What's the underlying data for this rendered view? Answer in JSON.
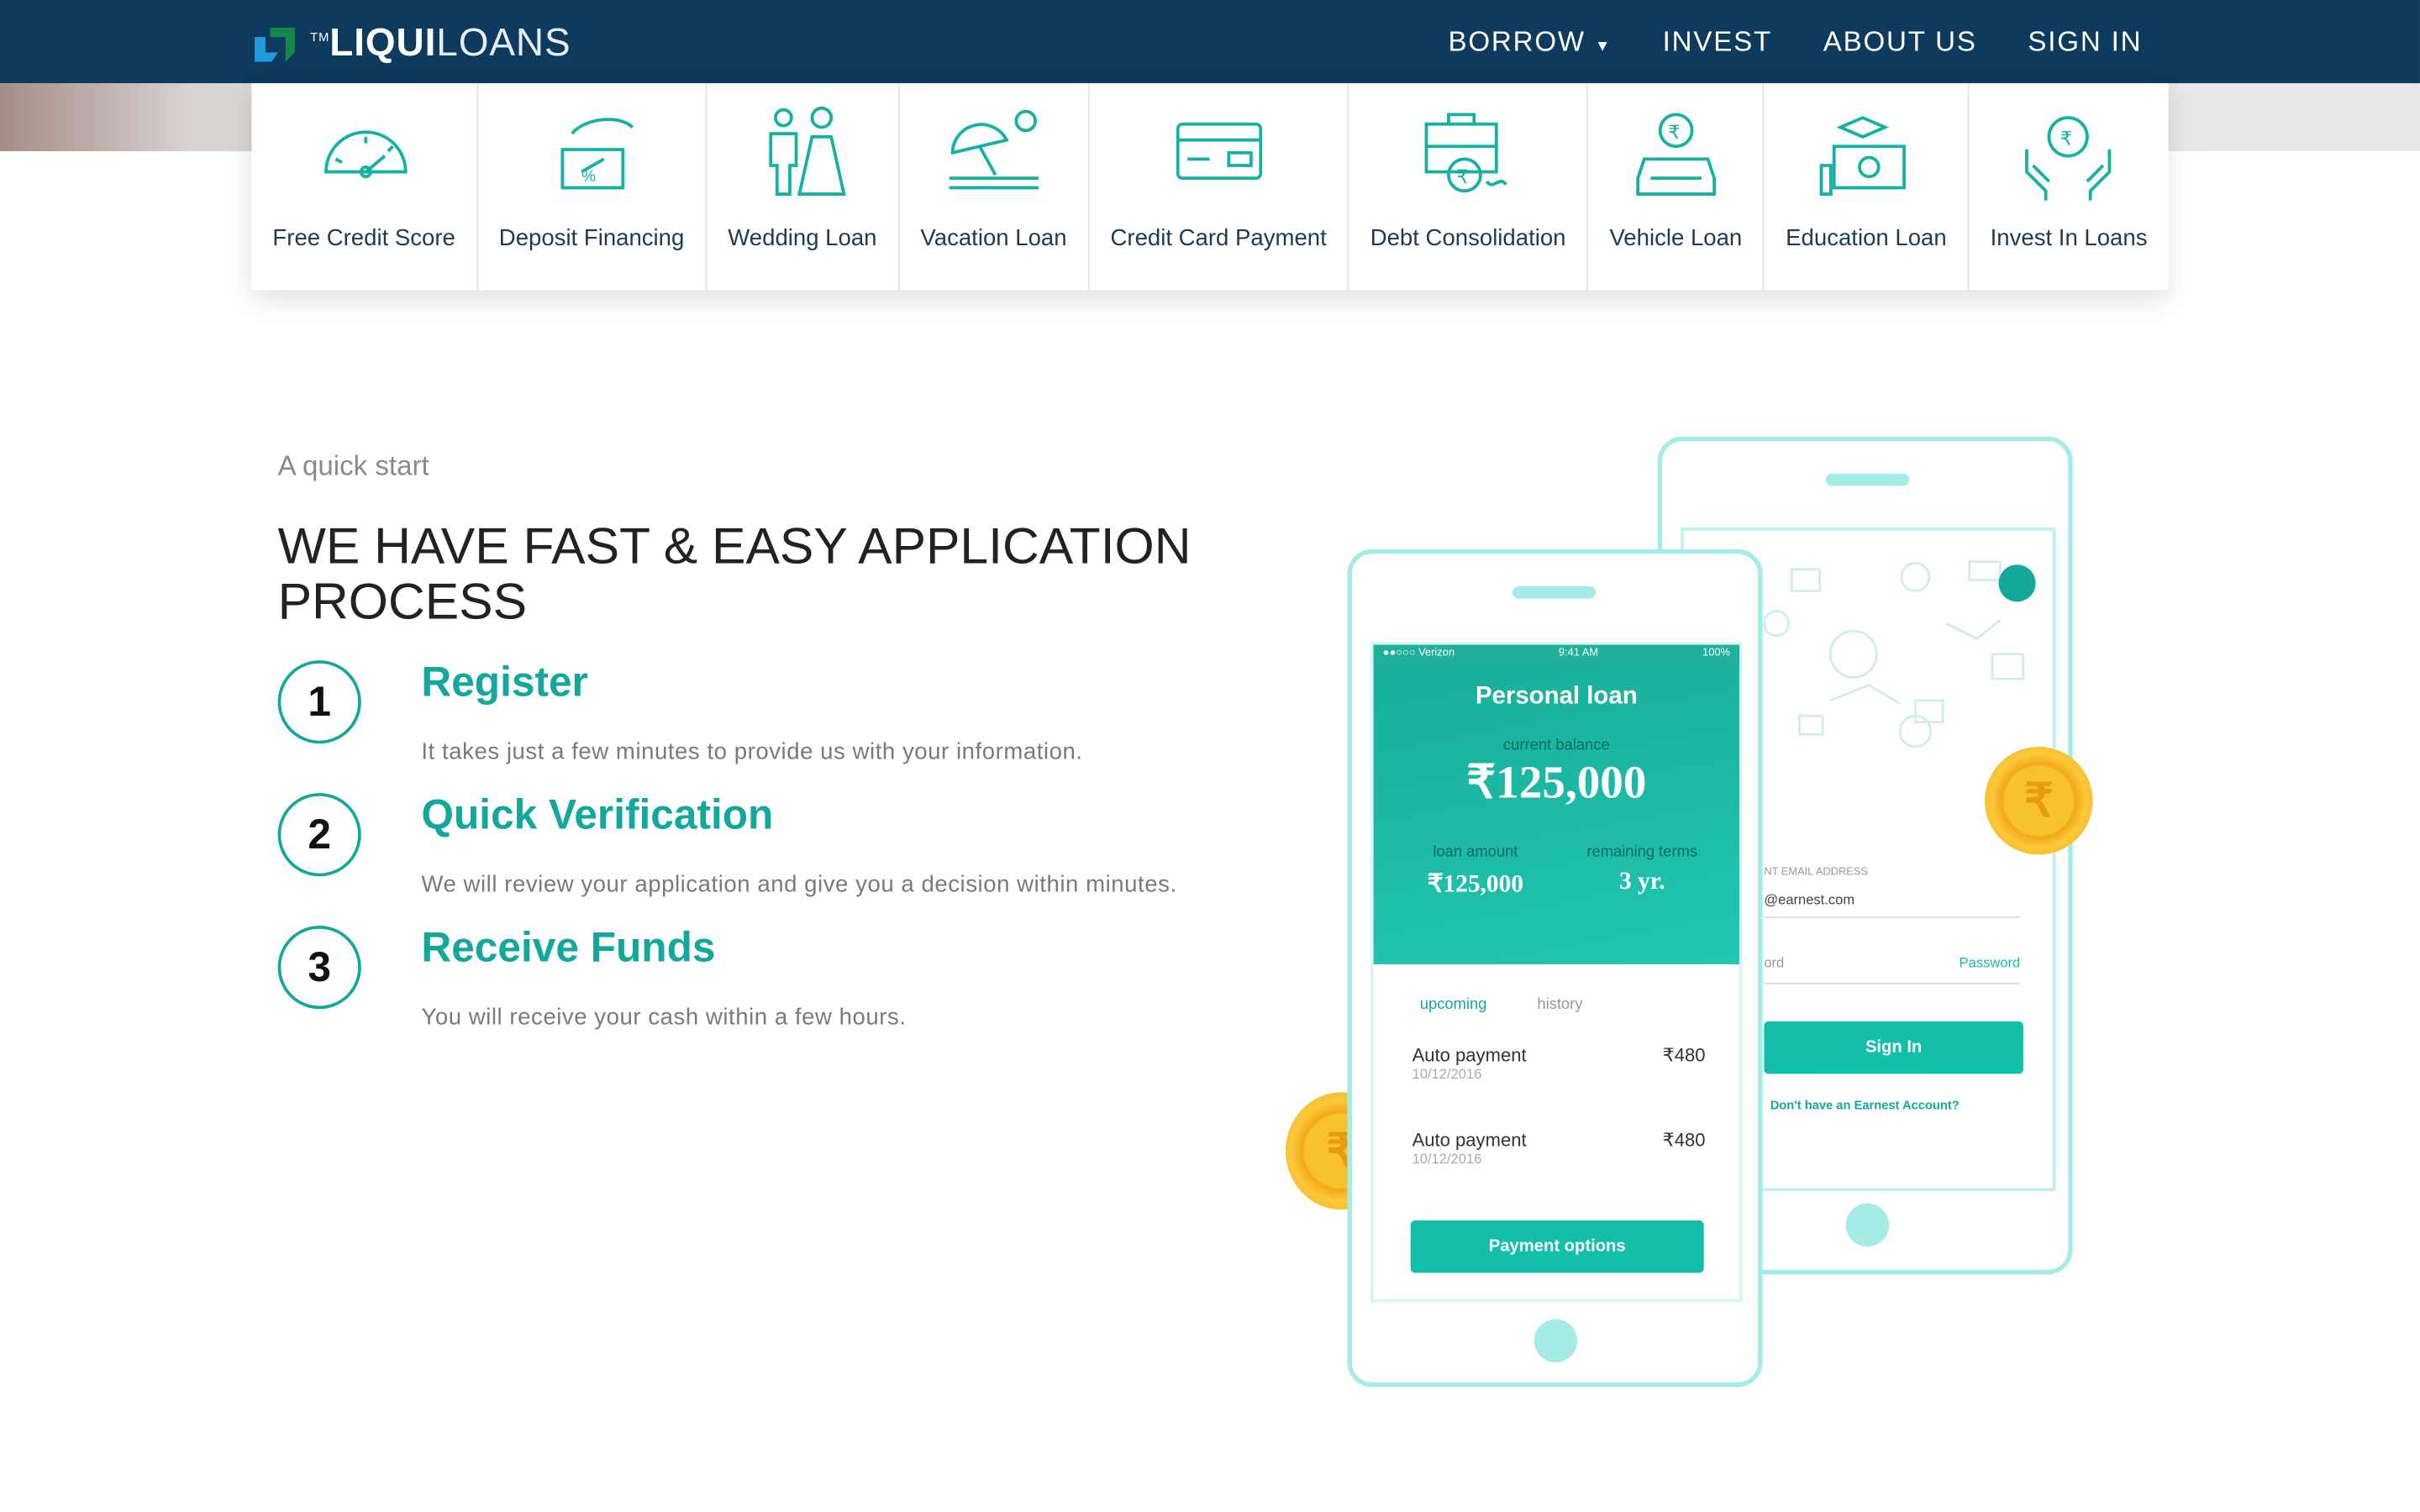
{
  "nav": {
    "logo": {
      "tm": "TM",
      "bold": "LIQUI",
      "light": "LOANS"
    },
    "links": [
      "BORROW",
      "INVEST",
      "ABOUT US",
      "SIGN IN"
    ]
  },
  "menu": {
    "items": [
      {
        "label": "Free Credit Score",
        "icon": "speedometer-icon"
      },
      {
        "label": "Deposit Financing",
        "icon": "hand-percent-icon"
      },
      {
        "label": "Wedding Loan",
        "icon": "wedding-couple-icon"
      },
      {
        "label": "Vacation Loan",
        "icon": "beach-umbrella-icon"
      },
      {
        "label": "Credit Card Payment",
        "icon": "credit-card-icon"
      },
      {
        "label": "Debt Consolidation",
        "icon": "briefcase-rupee-icon"
      },
      {
        "label": "Vehicle Loan",
        "icon": "car-rupee-icon"
      },
      {
        "label": "Education Loan",
        "icon": "graduation-money-icon"
      },
      {
        "label": "Invest In Loans",
        "icon": "hands-rupee-icon"
      }
    ]
  },
  "main": {
    "kicker": "A quick start",
    "heading": "WE HAVE FAST & EASY APPLICATION PROCESS",
    "steps": [
      {
        "num": "1",
        "title": "Register",
        "desc": "It takes just a few minutes to provide us with your information."
      },
      {
        "num": "2",
        "title": "Quick Verification",
        "desc": "We will review your application and give you a decision within minutes."
      },
      {
        "num": "3",
        "title": "Receive Funds",
        "desc": "You will receive your cash within a few hours."
      }
    ]
  },
  "phone_front": {
    "status": {
      "carrier": "●●○○○ Verizon",
      "time": "9:41 AM",
      "battery": "100%"
    },
    "title": "Personal loan",
    "balance_label": "current balance",
    "balance": "₹125,000",
    "loan_amount_label": "loan amount",
    "loan_amount": "₹125,000",
    "terms_label": "remaining terms",
    "terms": "3 yr.",
    "tabs": [
      "upcoming",
      "history"
    ],
    "payments": [
      {
        "name": "Auto payment",
        "date": "10/12/2016",
        "amount": "₹480"
      },
      {
        "name": "Auto payment",
        "date": "10/12/2016",
        "amount": "₹480"
      }
    ],
    "button": "Payment options"
  },
  "phone_back": {
    "email_label": "NT EMAIL ADDRESS",
    "email_value": "@earnest.com",
    "password_label": "ord",
    "password_link": "Password",
    "signin": "Sign In",
    "signup": "Don't have an Earnest Account?"
  },
  "coin_symbol": "₹",
  "colors": {
    "nav": "#0e3a5e",
    "accent": "#14a89c",
    "phone_teal": "#1fbfaa"
  }
}
